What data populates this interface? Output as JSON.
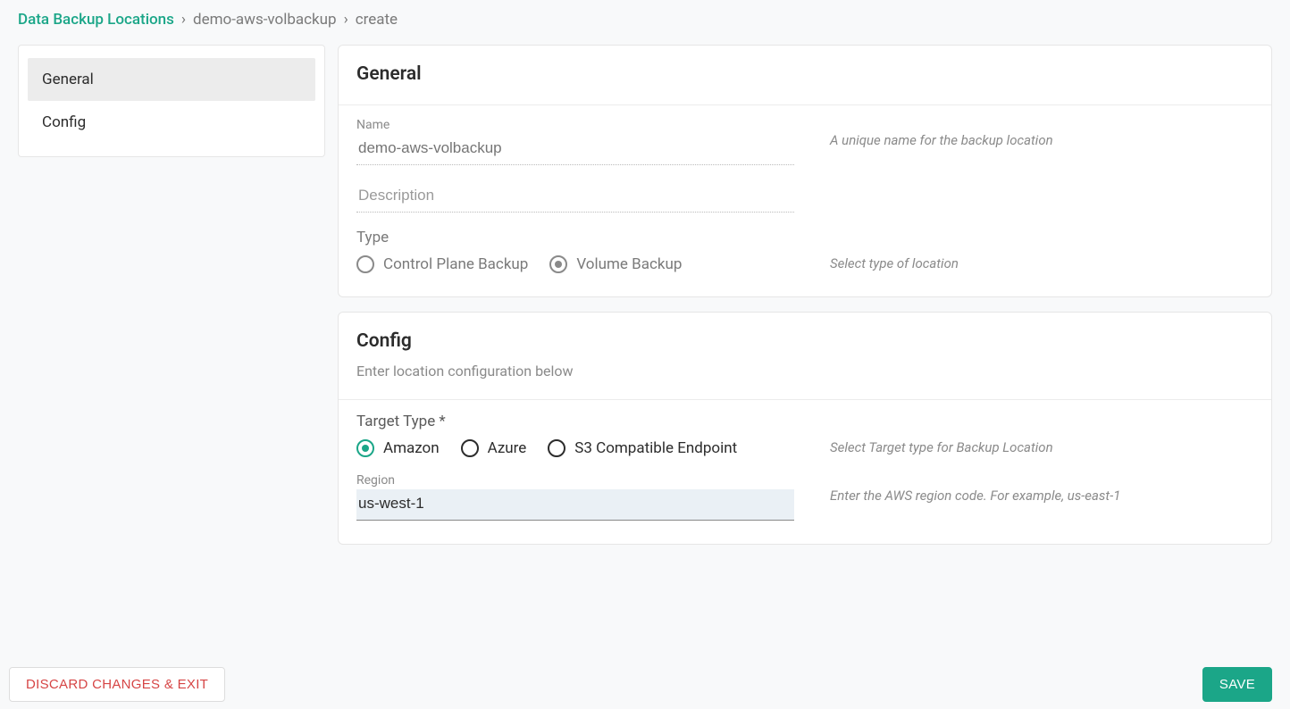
{
  "breadcrumb": {
    "root": "Data Backup Locations",
    "mid": "demo-aws-volbackup",
    "leaf": "create"
  },
  "sidebar": {
    "items": [
      {
        "label": "General",
        "active": true
      },
      {
        "label": "Config",
        "active": false
      }
    ]
  },
  "general": {
    "title": "General",
    "name_label": "Name",
    "name_value": "demo-aws-volbackup",
    "name_help": "A unique name for the backup location",
    "description_placeholder": "Description",
    "type_label": "Type",
    "type_help": "Select type of location",
    "type_options": [
      {
        "label": "Control Plane Backup",
        "selected": false
      },
      {
        "label": "Volume Backup",
        "selected": true
      }
    ]
  },
  "config": {
    "title": "Config",
    "subtitle": "Enter location configuration below",
    "target_type_label": "Target Type *",
    "target_type_help": "Select Target type for Backup Location",
    "target_type_options": [
      {
        "label": "Amazon",
        "selected": true
      },
      {
        "label": "Azure",
        "selected": false
      },
      {
        "label": "S3 Compatible Endpoint",
        "selected": false
      }
    ],
    "region_label": "Region",
    "region_value": "us-west-1",
    "region_help": "Enter the AWS region code. For example, us-east-1"
  },
  "footer": {
    "discard": "DISCARD CHANGES & EXIT",
    "save": "SAVE"
  }
}
